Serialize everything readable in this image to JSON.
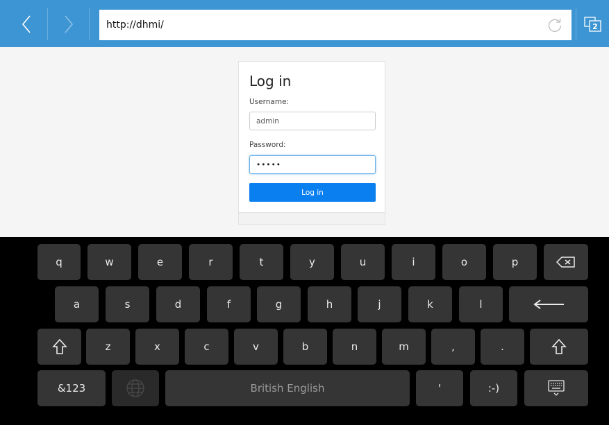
{
  "browser": {
    "url": "http://dhmi/",
    "tab_count": "2",
    "icons": {
      "back": "back-arrow-icon",
      "forward": "forward-arrow-icon",
      "reload": "reload-icon",
      "tabs": "tabs-icon"
    }
  },
  "login": {
    "title": "Log in",
    "username_label": "Username:",
    "username_value": "admin",
    "password_label": "Password:",
    "password_masked": "•••••",
    "button_label": "Log in"
  },
  "keyboard": {
    "row1": [
      "q",
      "w",
      "e",
      "r",
      "t",
      "y",
      "u",
      "i",
      "o",
      "p"
    ],
    "row2": [
      "a",
      "s",
      "d",
      "f",
      "g",
      "h",
      "j",
      "k",
      "l"
    ],
    "row3": [
      "z",
      "x",
      "c",
      "v",
      "b",
      "n",
      "m",
      ",",
      "."
    ],
    "symbols_label": "&123",
    "space_label": "British English",
    "apostrophe_label": "'",
    "smiley_label": ":-)",
    "icons": {
      "backspace": "backspace-icon",
      "enter": "enter-icon",
      "shift": "shift-icon",
      "language": "globe-icon",
      "hide": "keyboard-hide-icon"
    }
  },
  "colors": {
    "toolbar": "#3e95d3",
    "primary_button": "#0a7ff0",
    "key": "#353535"
  }
}
